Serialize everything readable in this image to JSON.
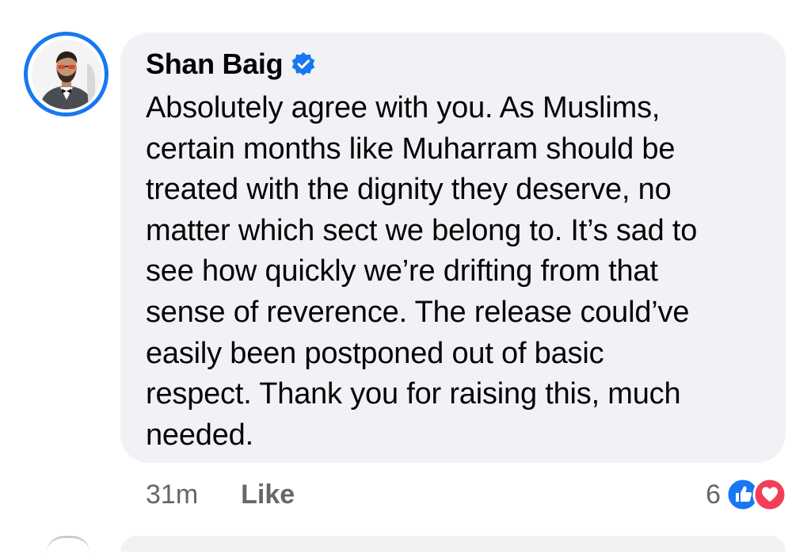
{
  "comment": {
    "author": "Shan Baig",
    "verified": true,
    "text": "Absolutely agree with you. As Muslims,\ncertain months like Muharram should be\ntreated with the dignity they deserve, no\nmatter which sect we belong to. It’s sad to\nsee how quickly we’re drifting from that\nsense of reverence. The release could’ve\neasily been postponed out of basic\nrespect. Thank you for raising this, much\nneeded.",
    "timestamp": "31m",
    "like_label": "Like",
    "reaction_count": "6",
    "reactions": [
      "like-icon",
      "love-icon"
    ]
  },
  "colors": {
    "accent": "#1877f2",
    "bubble": "#f0f2f5",
    "meta_text": "#65676b",
    "love": "#f33e58"
  }
}
